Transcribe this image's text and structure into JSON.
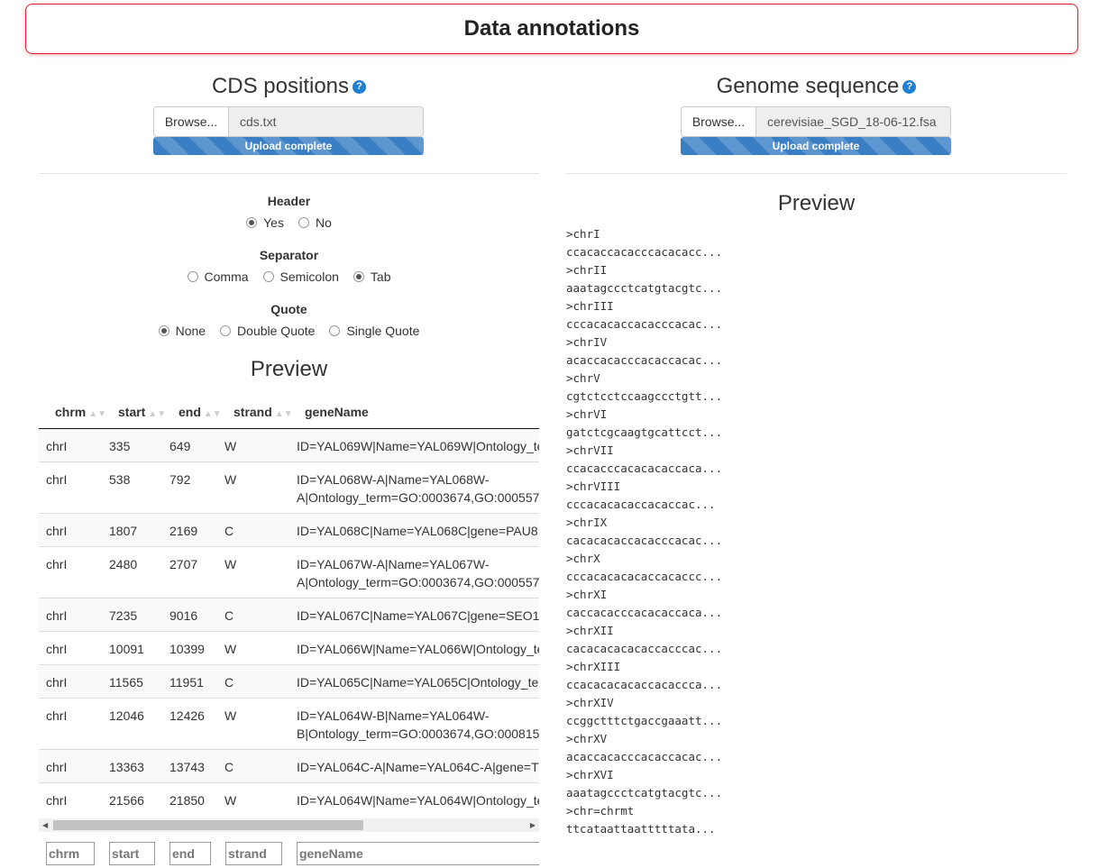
{
  "page": {
    "title": "Data annotations"
  },
  "cds": {
    "title": "CDS positions",
    "help": "?",
    "browse_label": "Browse...",
    "file_name": "cds.txt",
    "progress_label": "Upload complete",
    "header": {
      "label": "Header",
      "options": [
        "Yes",
        "No"
      ],
      "selected": "Yes"
    },
    "separator": {
      "label": "Separator",
      "options": [
        "Comma",
        "Semicolon",
        "Tab"
      ],
      "selected": "Tab"
    },
    "quote": {
      "label": "Quote",
      "options": [
        "None",
        "Double Quote",
        "Single Quote"
      ],
      "selected": "None"
    },
    "preview_title": "Preview",
    "columns": [
      "chrm",
      "start",
      "end",
      "strand",
      "geneName"
    ],
    "rows": [
      [
        "chrI",
        "335",
        "649",
        "W",
        "ID=YAL069W|Name=YAL069W|Ontology_te"
      ],
      [
        "chrI",
        "538",
        "792",
        "W",
        "ID=YAL068W-A|Name=YAL068W-A|Ontology_term=GO:0003674,GO:000557"
      ],
      [
        "chrI",
        "1807",
        "2169",
        "C",
        "ID=YAL068C|Name=YAL068C|gene=PAU8"
      ],
      [
        "chrI",
        "2480",
        "2707",
        "W",
        "ID=YAL067W-A|Name=YAL067W-A|Ontology_term=GO:0003674,GO:000557"
      ],
      [
        "chrI",
        "7235",
        "9016",
        "C",
        "ID=YAL067C|Name=YAL067C|gene=SEO1"
      ],
      [
        "chrI",
        "10091",
        "10399",
        "W",
        "ID=YAL066W|Name=YAL066W|Ontology_te"
      ],
      [
        "chrI",
        "11565",
        "11951",
        "C",
        "ID=YAL065C|Name=YAL065C|Ontology_te"
      ],
      [
        "chrI",
        "12046",
        "12426",
        "W",
        "ID=YAL064W-B|Name=YAL064W-B|Ontology_term=GO:0003674,GO:000815"
      ],
      [
        "chrI",
        "13363",
        "13743",
        "C",
        "ID=YAL064C-A|Name=YAL064C-A|gene=T"
      ],
      [
        "chrI",
        "21566",
        "21850",
        "W",
        "ID=YAL064W|Name=YAL064W|Ontology_te"
      ]
    ],
    "filters": [
      "chrm",
      "start",
      "end",
      "strand",
      "geneName"
    ]
  },
  "genome": {
    "title": "Genome sequence",
    "help": "?",
    "browse_label": "Browse...",
    "file_name": "cerevisiae_SGD_18-06-12.fsa",
    "progress_label": "Upload complete",
    "preview_title": "Preview",
    "sequences": [
      ">chrI",
      "ccacaccacacccacacacc...",
      ">chrII",
      "aaatagccctcatgtacgtc...",
      ">chrIII",
      "cccacacaccacacccacac...",
      ">chrIV",
      "acaccacacccacaccacac...",
      ">chrV",
      "cgtctcctccaagccctgtt...",
      ">chrVI",
      "gatctcgcaagtgcattcct...",
      ">chrVII",
      "ccacacccacacacaccaca...",
      ">chrVIII",
      "cccacacacaccacaccac...",
      ">chrIX",
      "cacacacaccacacccacac...",
      ">chrX",
      "cccacacacacaccacaccc...",
      ">chrXI",
      "caccacacccacacaccaca...",
      ">chrXII",
      "cacacacacacaccacccac...",
      ">chrXIII",
      "ccacacacacaccacaccca...",
      ">chrXIV",
      "ccggctttctgaccgaaatt...",
      ">chrXV",
      "acaccacacccacaccacac...",
      ">chrXVI",
      "aaatagccctcatgtacgtc...",
      ">chr=chrmt",
      "ttcataattaatttttata..."
    ]
  }
}
